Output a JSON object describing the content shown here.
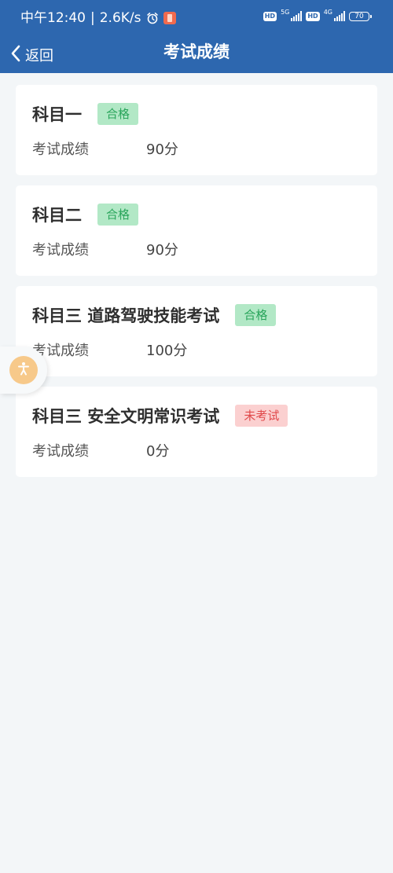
{
  "status_bar": {
    "time": "中午12:40",
    "speed": "2.6K/s",
    "battery": "70",
    "network1": "5G",
    "network2": "4G",
    "hd": "HD"
  },
  "header": {
    "back_label": "返回",
    "title": "考试成绩"
  },
  "results": [
    {
      "subject": "科目一",
      "status": "合格",
      "score_label": "考试成绩",
      "score": "90分"
    },
    {
      "subject": "科目二",
      "status": "合格",
      "score_label": "考试成绩",
      "score": "90分"
    },
    {
      "subject": "科目三 道路驾驶技能考试",
      "status": "合格",
      "score_label": "考试成绩",
      "score": "100分"
    },
    {
      "subject": "科目三 安全文明常识考试",
      "status": "未考试",
      "score_label": "考试成绩",
      "score": "0分"
    }
  ],
  "colors": {
    "header_bg": "#2d67af",
    "page_bg": "#f3f6f8",
    "pass_badge_bg": "#b2e8c6",
    "pass_badge_text": "#29a55b",
    "fail_badge_bg": "#fbd0d0",
    "fail_badge_text": "#e0484a"
  },
  "icons": {
    "back": "chevron-left-icon",
    "accessibility": "accessibility-icon",
    "alarm": "alarm-clock-icon"
  }
}
